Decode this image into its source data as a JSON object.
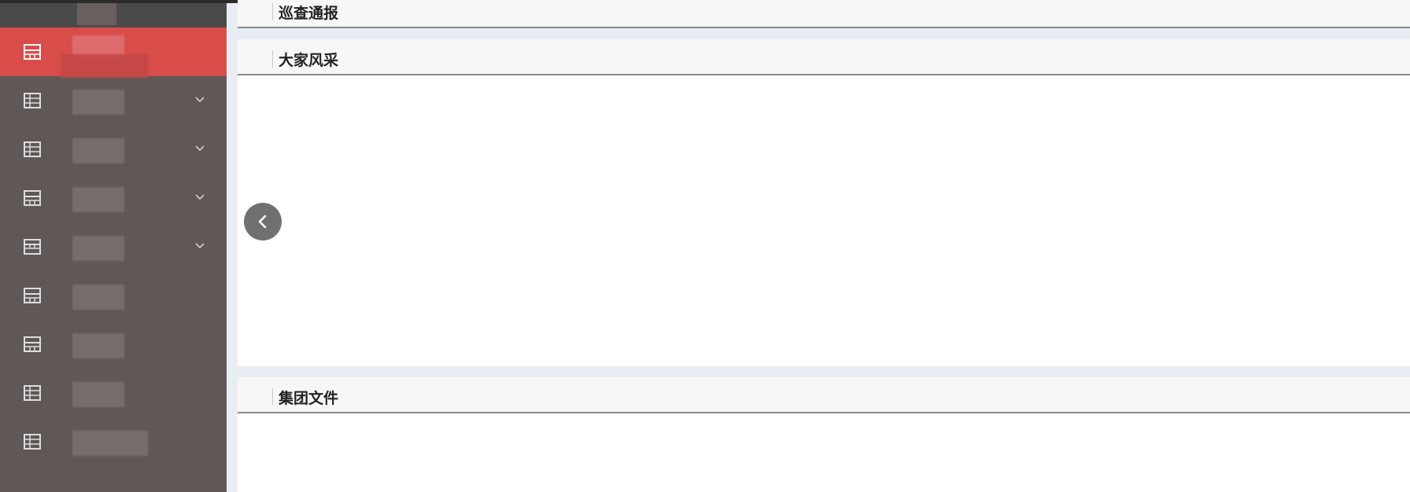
{
  "sidebar": {
    "items": [
      {
        "icon": "table-icon",
        "active": true,
        "has_chevron": false
      },
      {
        "icon": "table-icon",
        "active": false,
        "has_chevron": true
      },
      {
        "icon": "table-icon",
        "active": false,
        "has_chevron": true
      },
      {
        "icon": "table-icon",
        "active": false,
        "has_chevron": true
      },
      {
        "icon": "table-icon",
        "active": false,
        "has_chevron": true
      },
      {
        "icon": "table-icon",
        "active": false,
        "has_chevron": false
      },
      {
        "icon": "table-icon",
        "active": false,
        "has_chevron": false
      },
      {
        "icon": "table-icon",
        "active": false,
        "has_chevron": false
      },
      {
        "icon": "table-icon",
        "active": false,
        "has_chevron": false
      }
    ],
    "accent_color": "#d84c4a",
    "background_color": "#605856"
  },
  "panels": {
    "inspection": {
      "title": "巡查通报"
    },
    "style": {
      "title": "大家风采"
    },
    "docs": {
      "title": "集团文件"
    }
  },
  "carousel": {
    "prev_icon": "chevron-left-icon"
  }
}
